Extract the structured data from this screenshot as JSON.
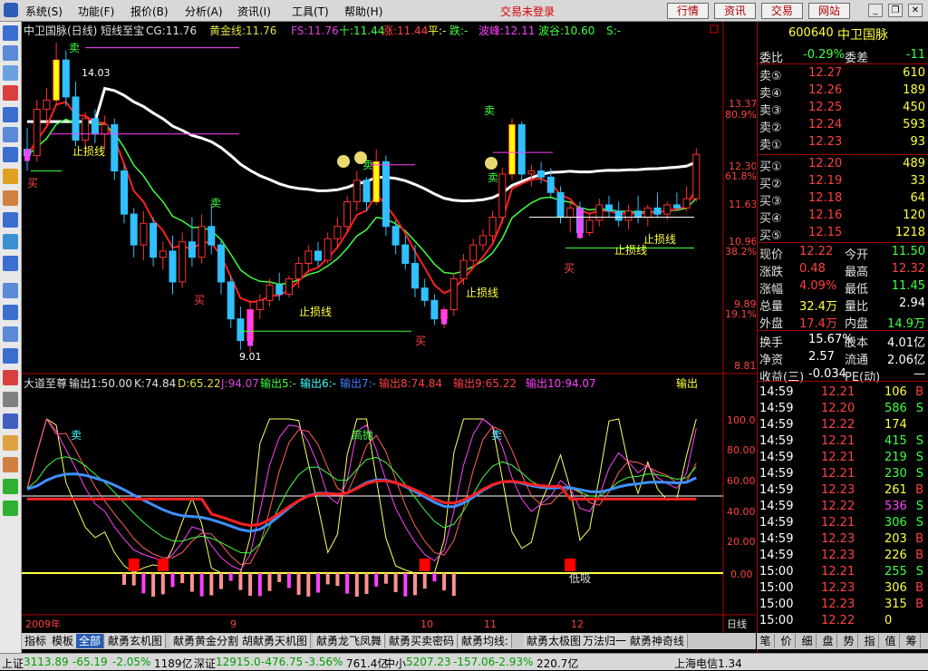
{
  "menubar": {
    "items": [
      "系统(S)",
      "功能(F)",
      "报价(B)",
      "分析(A)",
      "资讯(I)",
      "工具(T)",
      "帮助(H)"
    ],
    "status": "交易未登录",
    "buttons": [
      "行情",
      "资讯",
      "交易",
      "网站"
    ]
  },
  "main_header": {
    "title": "中卫国脉(日线) 短线至宝",
    "cg": "CG:11.76",
    "huangjin": "黄金线:11.76",
    "fs": "FS:11.76",
    "shi": "十:11.44",
    "zhang": "涨:11.44",
    "ping": "平:-",
    "die": "跌:-",
    "bofeng": "波峰:12.11",
    "bogu": "波谷:10.60",
    "s": "S:-"
  },
  "sub_header": {
    "title": "大道至尊",
    "out1": "输出1:50.00",
    "k": "K:74.84",
    "d": "D:65.22",
    "j": "J:94.07",
    "out5": "输出5:-",
    "out6": "输出6:-",
    "out7": "输出7:-",
    "out8": "输出8:74.84",
    "out9": "输出9:65.22",
    "out10": "输出10:94.07",
    "right_label": "输出"
  },
  "annotations": {
    "sell": "卖",
    "buy": "买",
    "sell_star": "卖",
    "stop_loss": "止损线",
    "gaopao": "高抛",
    "dixi": "低吸",
    "high_label": "14.03",
    "low_label": "9.01"
  },
  "date_axis": {
    "labels": [
      "2009年",
      "9",
      "10",
      "11",
      "12"
    ],
    "period": "日线"
  },
  "price_axis": {
    "labels": [
      "13.37",
      "80.9%",
      "12.30",
      "61.8%",
      "11.63",
      "10.96",
      "38.2%",
      "9.89",
      "19.1%",
      "8.81"
    ]
  },
  "osc_axis": {
    "labels": [
      "100.0",
      "80.00",
      "60.00",
      "40.00",
      "20.00",
      "0.00"
    ]
  },
  "quote": {
    "code": "600640",
    "name": "中卫国脉",
    "weibi_label": "委比",
    "weibi": "-0.29%",
    "weicha_label": "委差",
    "weicha": "-11",
    "asks": [
      {
        "label": "卖⑤",
        "price": "12.27",
        "vol": "610"
      },
      {
        "label": "卖④",
        "price": "12.26",
        "vol": "189"
      },
      {
        "label": "卖③",
        "price": "12.25",
        "vol": "450"
      },
      {
        "label": "卖②",
        "price": "12.24",
        "vol": "593"
      },
      {
        "label": "卖①",
        "price": "12.23",
        "vol": "93"
      }
    ],
    "bids": [
      {
        "label": "买①",
        "price": "12.20",
        "vol": "489"
      },
      {
        "label": "买②",
        "price": "12.19",
        "vol": "33"
      },
      {
        "label": "买③",
        "price": "12.18",
        "vol": "64"
      },
      {
        "label": "买④",
        "price": "12.16",
        "vol": "120"
      },
      {
        "label": "买⑤",
        "price": "12.15",
        "vol": "1218"
      }
    ],
    "stats": [
      {
        "l1": "现价",
        "v1": "12.22",
        "c1": "#ff4040",
        "l2": "今开",
        "v2": "11.50",
        "c2": "#40ff40"
      },
      {
        "l1": "涨跌",
        "v1": "0.48",
        "c1": "#ff4040",
        "l2": "最高",
        "v2": "12.32",
        "c2": "#ff4040"
      },
      {
        "l1": "涨幅",
        "v1": "4.09%",
        "c1": "#ff4040",
        "l2": "最低",
        "v2": "11.45",
        "c2": "#40ff40"
      },
      {
        "l1": "总量",
        "v1": "32.4万",
        "c1": "#ffff40",
        "l2": "量比",
        "v2": "2.94",
        "c2": "#ffffff"
      },
      {
        "l1": "外盘",
        "v1": "17.4万",
        "c1": "#ff4040",
        "l2": "内盘",
        "v2": "14.9万",
        "c2": "#40ff40"
      }
    ],
    "stats2": [
      {
        "l1": "换手",
        "v1": "15.67%",
        "l2": "股本",
        "v2": "4.01亿"
      },
      {
        "l1": "净资",
        "v1": "2.57",
        "l2": "流通",
        "v2": "2.06亿"
      },
      {
        "l1": "收益(三)",
        "v1": "-0.034",
        "l2": "PE(动)",
        "v2": "—"
      }
    ],
    "ticks": [
      {
        "t": "14:59",
        "p": "12.21",
        "v": "106",
        "bs": "B"
      },
      {
        "t": "14:59",
        "p": "12.20",
        "v": "586",
        "bs": "S"
      },
      {
        "t": "14:59",
        "p": "12.22",
        "v": "174",
        "bs": ""
      },
      {
        "t": "14:59",
        "p": "12.21",
        "v": "415",
        "bs": "S"
      },
      {
        "t": "14:59",
        "p": "12.21",
        "v": "219",
        "bs": "S"
      },
      {
        "t": "14:59",
        "p": "12.21",
        "v": "230",
        "bs": "S"
      },
      {
        "t": "14:59",
        "p": "12.23",
        "v": "261",
        "bs": "B"
      },
      {
        "t": "14:59",
        "p": "12.22",
        "v": "536",
        "bs": "S"
      },
      {
        "t": "14:59",
        "p": "12.21",
        "v": "306",
        "bs": "S"
      },
      {
        "t": "14:59",
        "p": "12.23",
        "v": "203",
        "bs": "B"
      },
      {
        "t": "14:59",
        "p": "12.23",
        "v": "226",
        "bs": "B"
      },
      {
        "t": "15:00",
        "p": "12.21",
        "v": "255",
        "bs": "S"
      },
      {
        "t": "15:00",
        "p": "12.23",
        "v": "306",
        "bs": "B"
      },
      {
        "t": "15:00",
        "p": "12.23",
        "v": "315",
        "bs": "B"
      },
      {
        "t": "15:00",
        "p": "12.22",
        "v": "0",
        "bs": ""
      }
    ]
  },
  "bottom_tabs": [
    "指标",
    "模板",
    "全部",
    "献勇玄机图",
    "献勇黄金分割",
    "胡献勇天机图",
    "献勇龙飞凤舞",
    "献勇买卖密码",
    "献勇均线:",
    "献勇太极图",
    "万法归一",
    "献勇神奇线"
  ],
  "right_tabs": [
    "笔",
    "价",
    "细",
    "盘",
    "势",
    "指",
    "值",
    "筹"
  ],
  "statusbar": {
    "sh_label": "上证",
    "sh_val": "3113.89",
    "sh_chg": "-65.19",
    "sh_pct": "-2.05%",
    "sh_amt": "1189亿",
    "sz_label": "深证",
    "sz_val": "12915.0",
    "sz_chg": "-476.75",
    "sz_pct": "-3.56%",
    "sz_amt": "761.4亿",
    "zx_label": "中小",
    "zx_val": "5207.23",
    "zx_chg": "-157.06",
    "zx_pct": "-2.93%",
    "zx_amt": "220.7亿",
    "server": "上海电信1.34"
  },
  "chart_data": {
    "type": "candlestick",
    "price_range": [
      8.81,
      13.37
    ],
    "candles": [
      [
        12.3,
        12.65,
        11.95,
        12.2
      ],
      [
        12.2,
        13.1,
        12.1,
        12.95
      ],
      [
        12.95,
        13.3,
        12.7,
        13.1
      ],
      [
        13.1,
        14.03,
        13.0,
        13.75
      ],
      [
        13.75,
        13.9,
        13.0,
        13.15
      ],
      [
        13.15,
        13.4,
        12.35,
        12.45
      ],
      [
        12.45,
        12.9,
        12.3,
        12.8
      ],
      [
        12.8,
        12.95,
        12.4,
        12.55
      ],
      [
        12.55,
        12.85,
        12.3,
        12.7
      ],
      [
        12.7,
        12.8,
        11.8,
        11.95
      ],
      [
        11.95,
        12.05,
        11.1,
        11.25
      ],
      [
        11.25,
        11.35,
        10.55,
        10.75
      ],
      [
        10.75,
        11.3,
        10.5,
        11.1
      ],
      [
        11.1,
        11.2,
        10.4,
        10.55
      ],
      [
        10.55,
        10.8,
        10.35,
        10.65
      ],
      [
        10.65,
        10.9,
        9.95,
        10.15
      ],
      [
        10.15,
        10.95,
        10.05,
        10.8
      ],
      [
        10.8,
        11.2,
        10.4,
        10.55
      ],
      [
        10.55,
        11.25,
        10.45,
        11.05
      ],
      [
        11.05,
        11.4,
        10.6,
        10.75
      ],
      [
        10.75,
        10.85,
        9.95,
        10.15
      ],
      [
        10.15,
        10.25,
        9.4,
        9.55
      ],
      [
        9.55,
        9.75,
        9.05,
        9.2
      ],
      [
        9.2,
        9.85,
        9.01,
        9.7
      ],
      [
        9.7,
        9.95,
        9.55,
        9.85
      ],
      [
        9.85,
        10.2,
        9.75,
        10.1
      ],
      [
        10.1,
        10.3,
        9.85,
        9.95
      ],
      [
        9.95,
        10.25,
        9.9,
        10.2
      ],
      [
        10.2,
        10.55,
        10.05,
        10.45
      ],
      [
        10.45,
        10.75,
        10.3,
        10.65
      ],
      [
        10.65,
        10.8,
        10.4,
        10.5
      ],
      [
        10.5,
        10.95,
        10.45,
        10.85
      ],
      [
        10.85,
        11.2,
        10.7,
        11.05
      ],
      [
        11.05,
        11.55,
        10.95,
        11.45
      ],
      [
        11.45,
        11.95,
        11.3,
        11.8
      ],
      [
        11.8,
        11.85,
        11.3,
        11.45
      ],
      [
        11.45,
        12.3,
        11.4,
        12.1
      ],
      [
        12.1,
        12.2,
        10.9,
        11.05
      ],
      [
        11.05,
        11.15,
        10.6,
        10.75
      ],
      [
        10.75,
        10.9,
        10.35,
        10.45
      ],
      [
        10.45,
        10.75,
        9.9,
        10.05
      ],
      [
        10.05,
        10.2,
        9.75,
        9.85
      ],
      [
        9.85,
        9.95,
        9.45,
        9.55
      ],
      [
        9.55,
        9.75,
        9.4,
        9.7
      ],
      [
        9.7,
        10.3,
        9.6,
        10.2
      ],
      [
        10.2,
        10.6,
        10.1,
        10.5
      ],
      [
        10.5,
        10.85,
        10.4,
        10.75
      ],
      [
        10.75,
        11.0,
        10.65,
        10.9
      ],
      [
        10.9,
        11.3,
        10.8,
        11.2
      ],
      [
        11.2,
        12.0,
        11.1,
        11.9
      ],
      [
        11.9,
        12.8,
        11.8,
        12.7
      ],
      [
        12.7,
        12.75,
        11.8,
        11.9
      ],
      [
        11.9,
        12.05,
        11.7,
        11.95
      ],
      [
        11.95,
        12.1,
        11.75,
        11.85
      ],
      [
        11.85,
        12.0,
        11.5,
        11.6
      ],
      [
        11.6,
        11.7,
        11.1,
        11.2
      ],
      [
        11.2,
        11.45,
        10.95,
        11.35
      ],
      [
        11.35,
        11.45,
        10.85,
        10.95
      ],
      [
        10.95,
        11.25,
        10.9,
        11.15
      ],
      [
        11.15,
        11.5,
        11.05,
        11.4
      ],
      [
        11.4,
        11.55,
        11.2,
        11.3
      ],
      [
        11.3,
        11.45,
        11.05,
        11.15
      ],
      [
        11.15,
        11.4,
        11.0,
        11.3
      ],
      [
        11.3,
        11.55,
        11.1,
        11.2
      ],
      [
        11.2,
        11.4,
        11.05,
        11.35
      ],
      [
        11.35,
        11.6,
        11.2,
        11.25
      ],
      [
        11.25,
        11.45,
        11.15,
        11.4
      ],
      [
        11.4,
        11.6,
        11.3,
        11.35
      ],
      [
        11.35,
        11.7,
        11.3,
        11.5
      ],
      [
        11.5,
        12.32,
        11.45,
        12.22
      ]
    ],
    "osc_range": [
      0,
      100
    ]
  }
}
